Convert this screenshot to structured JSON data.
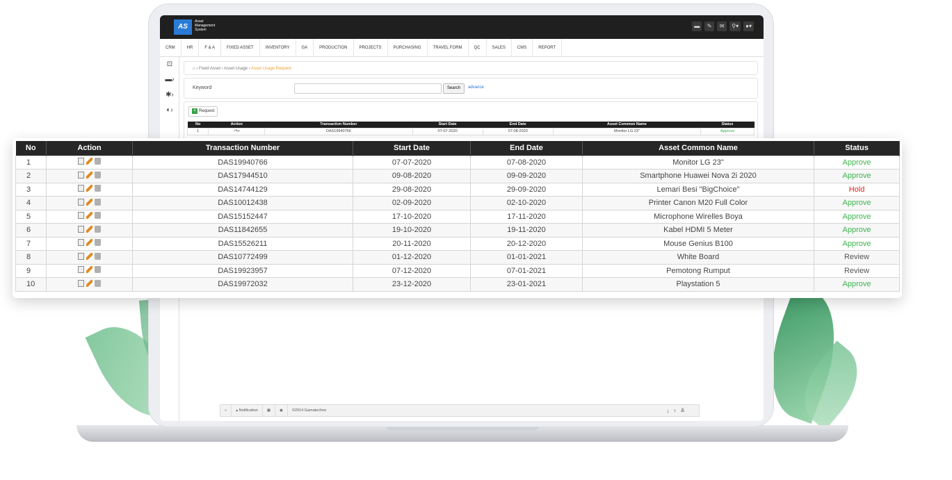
{
  "app": {
    "logo_text": "AS",
    "logo_subtitle": "Asset Management System"
  },
  "topbar_icons": [
    "folder-icon",
    "wrench-icon",
    "mail-icon",
    "search-icon",
    "user-icon"
  ],
  "menu": [
    "CRM",
    "HR",
    "F & A",
    "FIXED ASSET",
    "INVENTORY",
    "GA",
    "PRODUCTION",
    "PROJECTS",
    "PURCHASING",
    "TRAVEL FORM",
    "QC",
    "SALES",
    "CMS",
    "REPORT"
  ],
  "breadcrumb": {
    "items": [
      "Fixed Asset",
      "Asset Usage"
    ],
    "active": "Asset Usage Request"
  },
  "search": {
    "label": "Keyword",
    "button": "Search",
    "advance": "advance"
  },
  "request_button": "Request",
  "table": {
    "headers": [
      "No",
      "Action",
      "Transaction Number",
      "Start Date",
      "End Date",
      "Asset Common Name",
      "Status"
    ],
    "rows": [
      {
        "no": "1",
        "txn": "DAS19940766",
        "start": "07-07-2020",
        "end": "07-08-2020",
        "asset": "Monitor LG 23\"",
        "status": "Approve"
      },
      {
        "no": "2",
        "txn": "DAS17944510",
        "start": "09-08-2020",
        "end": "09-09-2020",
        "asset": "Smartphone Huawei Nova 2i 2020",
        "status": "Approve"
      },
      {
        "no": "3",
        "txn": "DAS14744129",
        "start": "29-08-2020",
        "end": "29-09-2020",
        "asset": "Lemari Besi \"BigChoice\"",
        "status": "Hold"
      },
      {
        "no": "4",
        "txn": "DAS10012438",
        "start": "02-09-2020",
        "end": "02-10-2020",
        "asset": "Printer Canon M20 Full Color",
        "status": "Approve"
      },
      {
        "no": "5",
        "txn": "DAS15152447",
        "start": "17-10-2020",
        "end": "17-11-2020",
        "asset": "Microphone Wirelles Boya",
        "status": "Approve"
      },
      {
        "no": "6",
        "txn": "DAS11842655",
        "start": "19-10-2020",
        "end": "19-11-2020",
        "asset": "Kabel HDMI 5 Meter",
        "status": "Approve"
      },
      {
        "no": "7",
        "txn": "DAS15526211",
        "start": "20-11-2020",
        "end": "20-12-2020",
        "asset": "Mouse Genius B100",
        "status": "Approve"
      },
      {
        "no": "8",
        "txn": "DAS10772499",
        "start": "01-12-2020",
        "end": "01-01-2021",
        "asset": "White Board",
        "status": "Review"
      },
      {
        "no": "9",
        "txn": "DAS19923957",
        "start": "07-12-2020",
        "end": "07-01-2021",
        "asset": "Pemotong Rumput",
        "status": "Review"
      },
      {
        "no": "10",
        "txn": "DAS19972032",
        "start": "23-12-2020",
        "end": "23-01-2021",
        "asset": "Playstation 5",
        "status": "Approve"
      }
    ]
  },
  "footer": {
    "notification": "Notification",
    "copyright": "©2014 Gamatechno"
  },
  "colors": {
    "approve": "#39b54a",
    "hold": "#d9251c",
    "review": "#555555",
    "header_bg": "#262626",
    "accent": "#2a7bd6"
  }
}
